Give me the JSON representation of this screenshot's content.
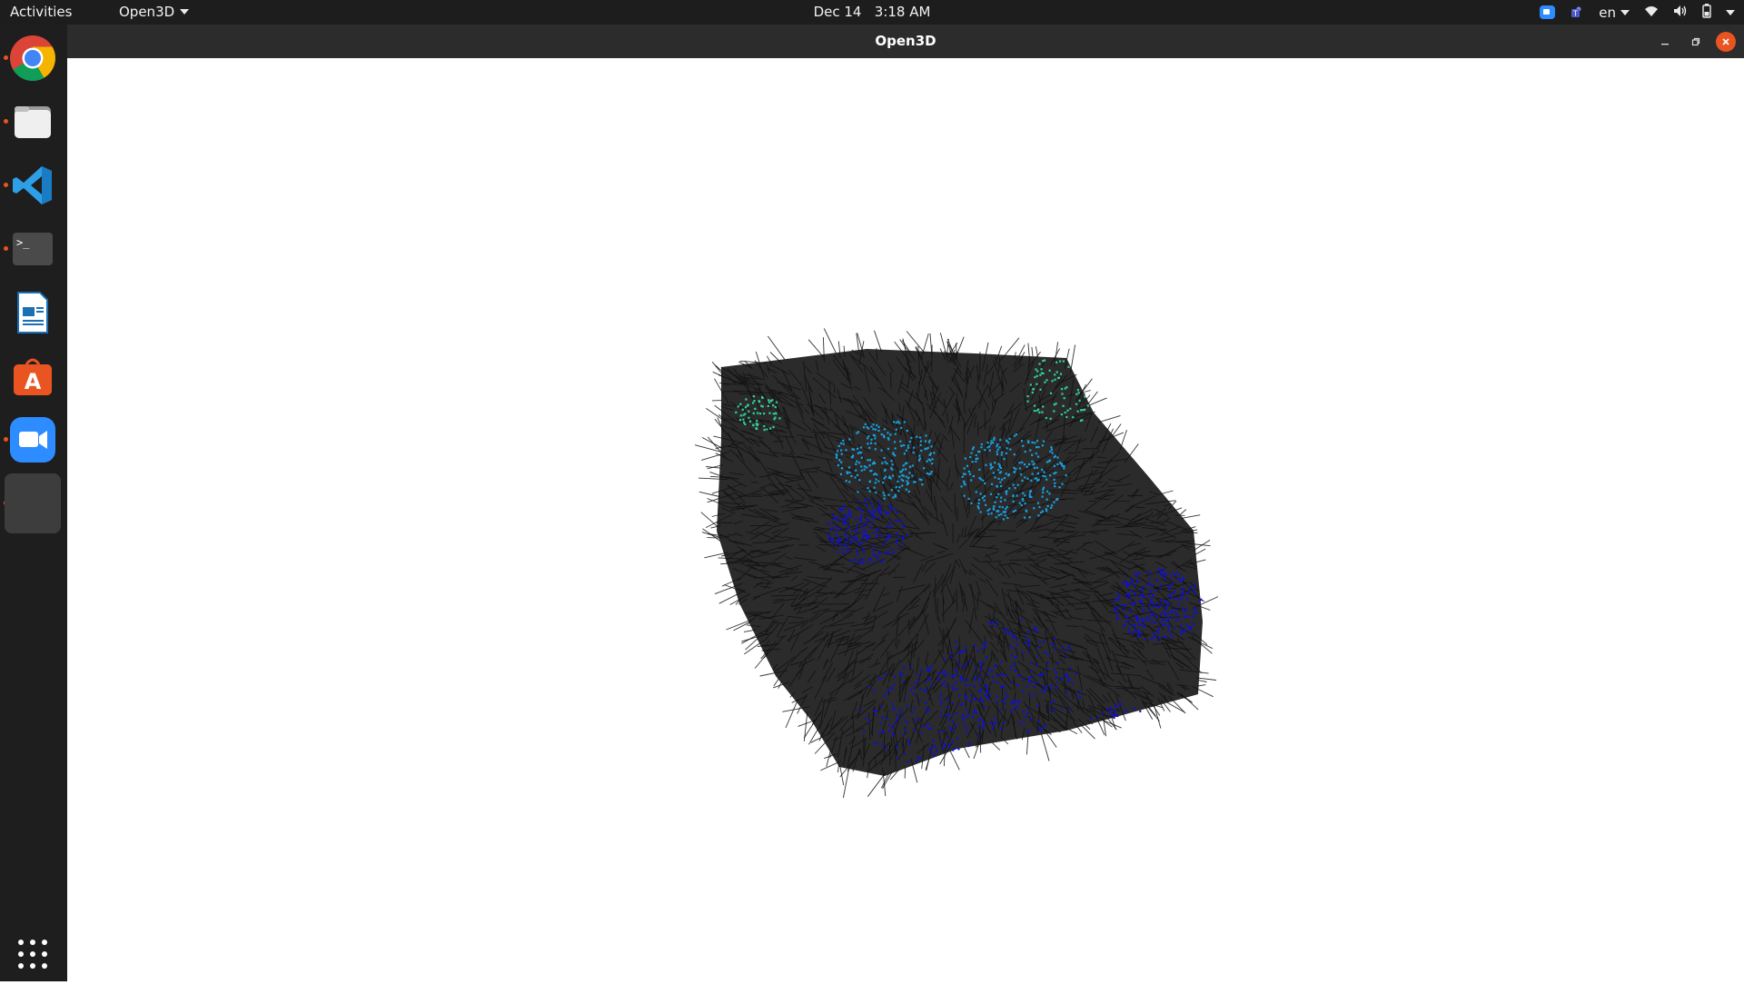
{
  "topbar": {
    "activities": "Activities",
    "app_menu": "Open3D",
    "date": "Dec 14",
    "time": "3:18 AM",
    "language": "en"
  },
  "dock": {
    "items": [
      {
        "name": "chrome-icon",
        "running": true
      },
      {
        "name": "files-icon",
        "running": true
      },
      {
        "name": "vscode-icon",
        "running": true
      },
      {
        "name": "terminal-icon",
        "running": true
      },
      {
        "name": "libreoffice-writer-icon",
        "running": false
      },
      {
        "name": "ubuntu-software-icon",
        "running": false
      },
      {
        "name": "zoom-icon",
        "running": true
      },
      {
        "name": "open3d-window-icon",
        "running": true
      },
      {
        "name": "show-apps-grid-icon",
        "running": false
      }
    ]
  },
  "window": {
    "title": "Open3D",
    "controls": [
      "minimize",
      "maximize",
      "close"
    ]
  },
  "viewer": {
    "content": "point cloud with surface normals",
    "colors": {
      "normals": "#111111",
      "points_primary": "#1010d0",
      "points_secondary": "#18a0e0",
      "points_tertiary": "#30d0a0"
    }
  }
}
